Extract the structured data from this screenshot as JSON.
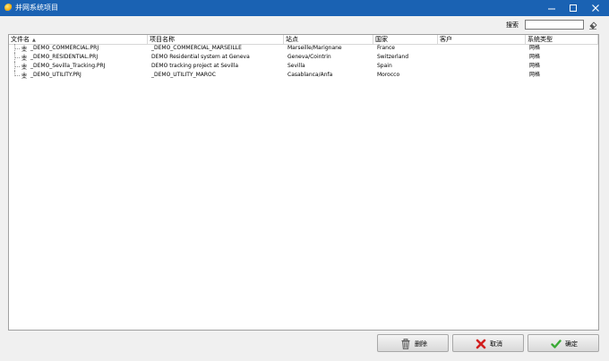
{
  "window": {
    "title": "并网系统项目"
  },
  "search": {
    "label": "搜索",
    "value": ""
  },
  "table": {
    "columns": [
      "文件名",
      "项目名称",
      "站点",
      "国家",
      "客户",
      "系统类型"
    ],
    "rows": [
      [
        "_DEMO_COMMERCIAL.PRJ",
        "_DEMO_COMMERCIAL_MARSEILLE",
        "Marseille/Marignane",
        "France",
        "",
        "网格"
      ],
      [
        "_DEMO_RESIDENTIAL.PRJ",
        "DEMO Residential system at Geneva",
        "Geneva/Cointrin",
        "Switzerland",
        "",
        "网格"
      ],
      [
        "_DEMO_Sevilla_Tracking.PRJ",
        "DEMO tracking project at Sevilla",
        "Sevilla",
        "Spain",
        "",
        "网格"
      ],
      [
        "_DEMO_UTILITY.PRJ",
        "_DEMO_UTILITY_MAROC",
        "Casablanca/Anfa",
        "Morocco",
        "",
        "网格"
      ]
    ]
  },
  "buttons": {
    "delete": "删除",
    "cancel": "取消",
    "ok": "确定"
  },
  "colors": {
    "titlebar": "#1a62b3",
    "ok_icon": "#3aaa35",
    "cancel_icon": "#d21f1f"
  }
}
